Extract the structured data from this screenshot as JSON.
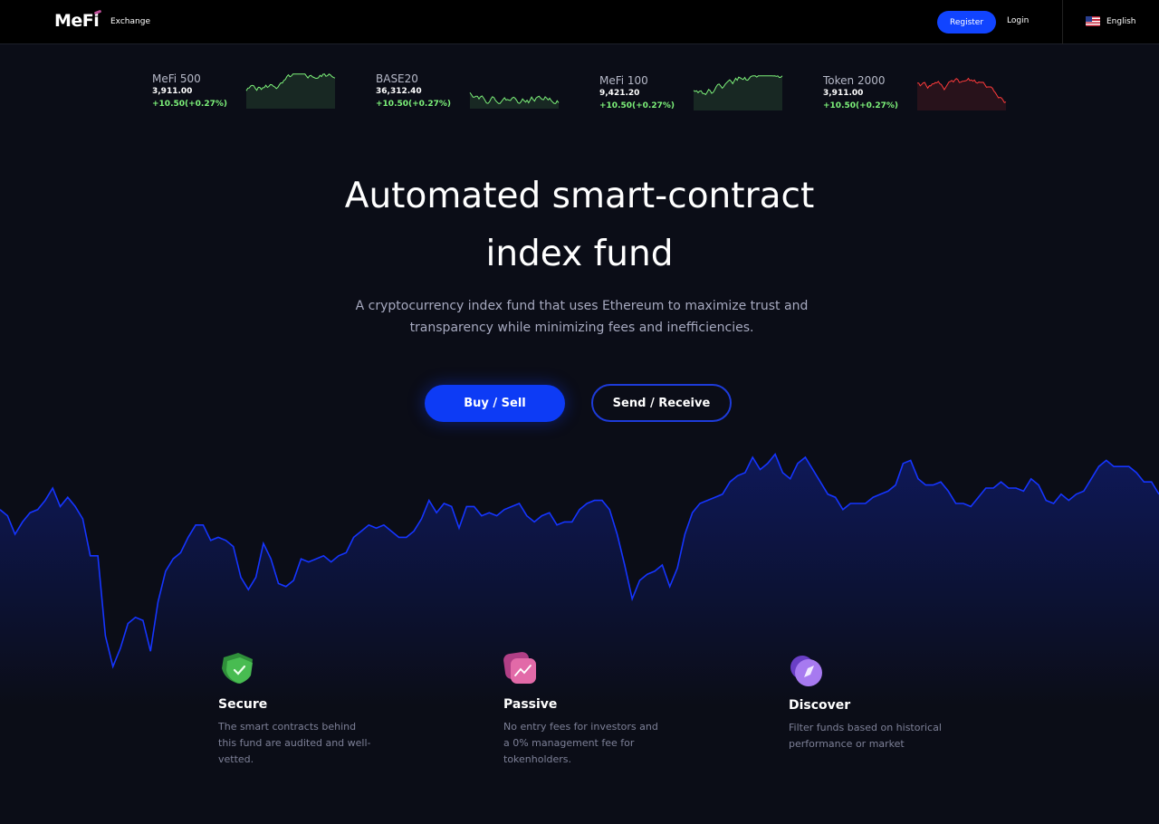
{
  "nav": {
    "logo": "MeFi",
    "logo_sub": "Exchange",
    "register_label": "Register",
    "login_label": "Login",
    "language": "English",
    "language_icon": "us-flag-icon"
  },
  "tickers": [
    {
      "name": "MeFi 500",
      "value": "3,911.00",
      "change": "+10.50(+0.27%)",
      "trend": "up",
      "color": "#7df27a"
    },
    {
      "name": "BASE20",
      "value": "36,312.40",
      "change": "+10.50(+0.27%)",
      "trend": "up",
      "color": "#7df27a"
    },
    {
      "name": "MeFi 100",
      "value": "9,421.20",
      "change": "+10.50(+0.27%)",
      "trend": "up",
      "color": "#7df27a"
    },
    {
      "name": "Token 2000",
      "value": "3,911.00",
      "change": "+10.50(+0.27%)",
      "trend": "down",
      "color": "#ff3b3b"
    }
  ],
  "hero": {
    "title_line1": "Automated smart-contract",
    "title_line2": "index fund",
    "subtitle": "A cryptocurrency index fund that uses Ethereum to maximize trust and transparency while minimizing fees and inefficiencies.",
    "buy_label": "Buy / Sell",
    "send_label": "Send / Receive"
  },
  "background_chart": {
    "color": "#1535ff",
    "values": [
      58,
      56,
      50,
      54,
      57,
      58,
      61,
      65,
      59,
      62,
      59,
      55,
      43,
      43,
      17,
      7,
      13,
      21,
      23,
      22,
      12,
      28,
      38,
      42,
      44,
      49,
      53,
      53,
      48,
      49,
      48,
      46,
      36,
      32,
      36,
      47,
      42,
      34,
      33,
      35,
      42,
      41,
      42,
      43,
      41,
      43,
      44,
      49,
      51,
      53,
      52,
      53,
      51,
      49,
      49,
      51,
      55,
      61,
      57,
      60,
      59,
      52,
      59,
      59,
      56,
      57,
      56,
      58,
      59,
      60,
      56,
      54,
      56,
      57,
      53,
      54,
      54,
      58,
      60,
      61,
      61,
      58,
      50,
      40,
      29,
      35,
      37,
      38,
      40,
      33,
      39,
      50,
      57,
      60,
      61,
      62,
      63,
      67,
      69,
      70,
      75,
      71,
      73,
      76,
      70,
      68,
      73,
      75,
      71,
      67,
      63,
      62,
      58,
      60,
      60,
      60,
      62,
      63,
      64,
      66,
      73,
      74,
      68,
      66,
      66,
      67,
      64,
      60,
      60,
      59,
      62,
      65,
      65,
      67,
      65,
      65,
      64,
      68,
      66,
      61,
      60,
      63,
      61,
      63,
      64,
      68,
      72,
      74,
      72,
      72,
      72,
      70,
      67,
      67,
      63
    ]
  },
  "features": [
    {
      "title": "Secure",
      "desc": "The smart contracts behind this fund are audited and well-vetted.",
      "icon": "shield-check-icon",
      "color": "#3fb24a"
    },
    {
      "title": "Passive",
      "desc": "No entry fees for investors and a 0% management fee for tokenholders.",
      "icon": "trend-chart-icon",
      "color": "#d94f96"
    },
    {
      "title": "Discover",
      "desc": "Filter funds based on historical performance or market",
      "icon": "compass-icon",
      "color": "#8e5be0"
    }
  ]
}
